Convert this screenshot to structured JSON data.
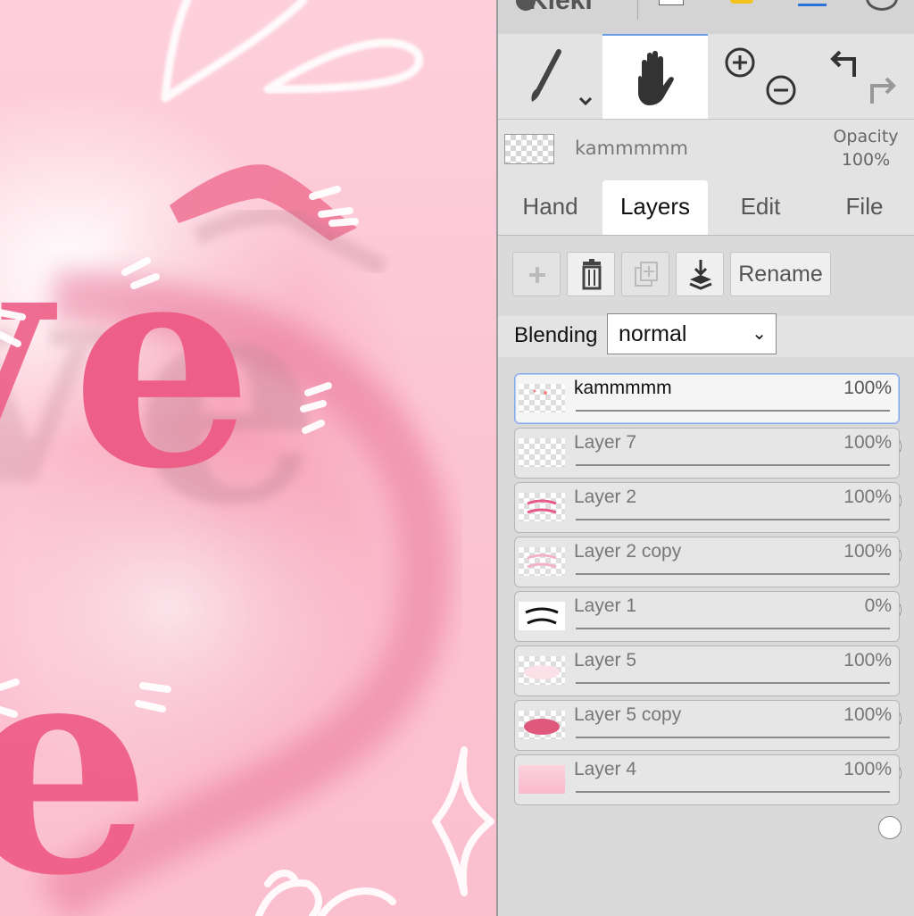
{
  "app": {
    "name": "Kleki"
  },
  "toolbar": {
    "tools": [
      {
        "name": "brush",
        "icon": "brush-icon",
        "has_dropdown": true,
        "active": false
      },
      {
        "name": "hand",
        "icon": "hand-icon",
        "active": true
      },
      {
        "name": "zoom",
        "icon": "zoom-in-out-icon",
        "active": false
      },
      {
        "name": "undo-redo",
        "icon": "undo-redo-icon",
        "active": false
      }
    ]
  },
  "current_layer": {
    "name": "kammmmm",
    "opacity_label": "Opacity",
    "opacity_value": "100%"
  },
  "tabs": [
    {
      "label": "Hand",
      "active": false
    },
    {
      "label": "Layers",
      "active": true
    },
    {
      "label": "Edit",
      "active": false
    },
    {
      "label": "File",
      "active": false
    }
  ],
  "layer_actions": {
    "add": {
      "icon": "plus-icon",
      "enabled": false
    },
    "delete": {
      "icon": "trash-icon",
      "enabled": true
    },
    "duplicate": {
      "icon": "duplicate-icon",
      "enabled": false
    },
    "merge_down": {
      "icon": "merge-down-icon",
      "enabled": true
    },
    "rename_label": "Rename"
  },
  "blending": {
    "label": "Blending",
    "value": "normal"
  },
  "layers": [
    {
      "name": "kammmmm",
      "opacity": "100%",
      "opacity_fraction": 1.0,
      "selected": true,
      "thumb": "transparent-pink-dots"
    },
    {
      "name": "Layer 7",
      "opacity": "100%",
      "opacity_fraction": 1.0,
      "selected": false,
      "thumb": "transparent"
    },
    {
      "name": "Layer 2",
      "opacity": "100%",
      "opacity_fraction": 1.0,
      "selected": false,
      "thumb": "pink-text"
    },
    {
      "name": "Layer 2 copy",
      "opacity": "100%",
      "opacity_fraction": 1.0,
      "selected": false,
      "thumb": "faint-pink-text"
    },
    {
      "name": "Layer 1",
      "opacity": "0%",
      "opacity_fraction": 0.0,
      "selected": false,
      "thumb": "black-text"
    },
    {
      "name": "Layer 5",
      "opacity": "100%",
      "opacity_fraction": 1.0,
      "selected": false,
      "thumb": "white-shape"
    },
    {
      "name": "Layer 5 copy",
      "opacity": "100%",
      "opacity_fraction": 1.0,
      "selected": false,
      "thumb": "pink-shape"
    },
    {
      "name": "Layer 4",
      "opacity": "100%",
      "opacity_fraction": 1.0,
      "selected": false,
      "thumb": "pink-fill"
    }
  ],
  "colors": {
    "accent_blue": "#2a73d9",
    "canvas_pink": "#fcc9d6",
    "ink_pink": "#ef6089"
  }
}
